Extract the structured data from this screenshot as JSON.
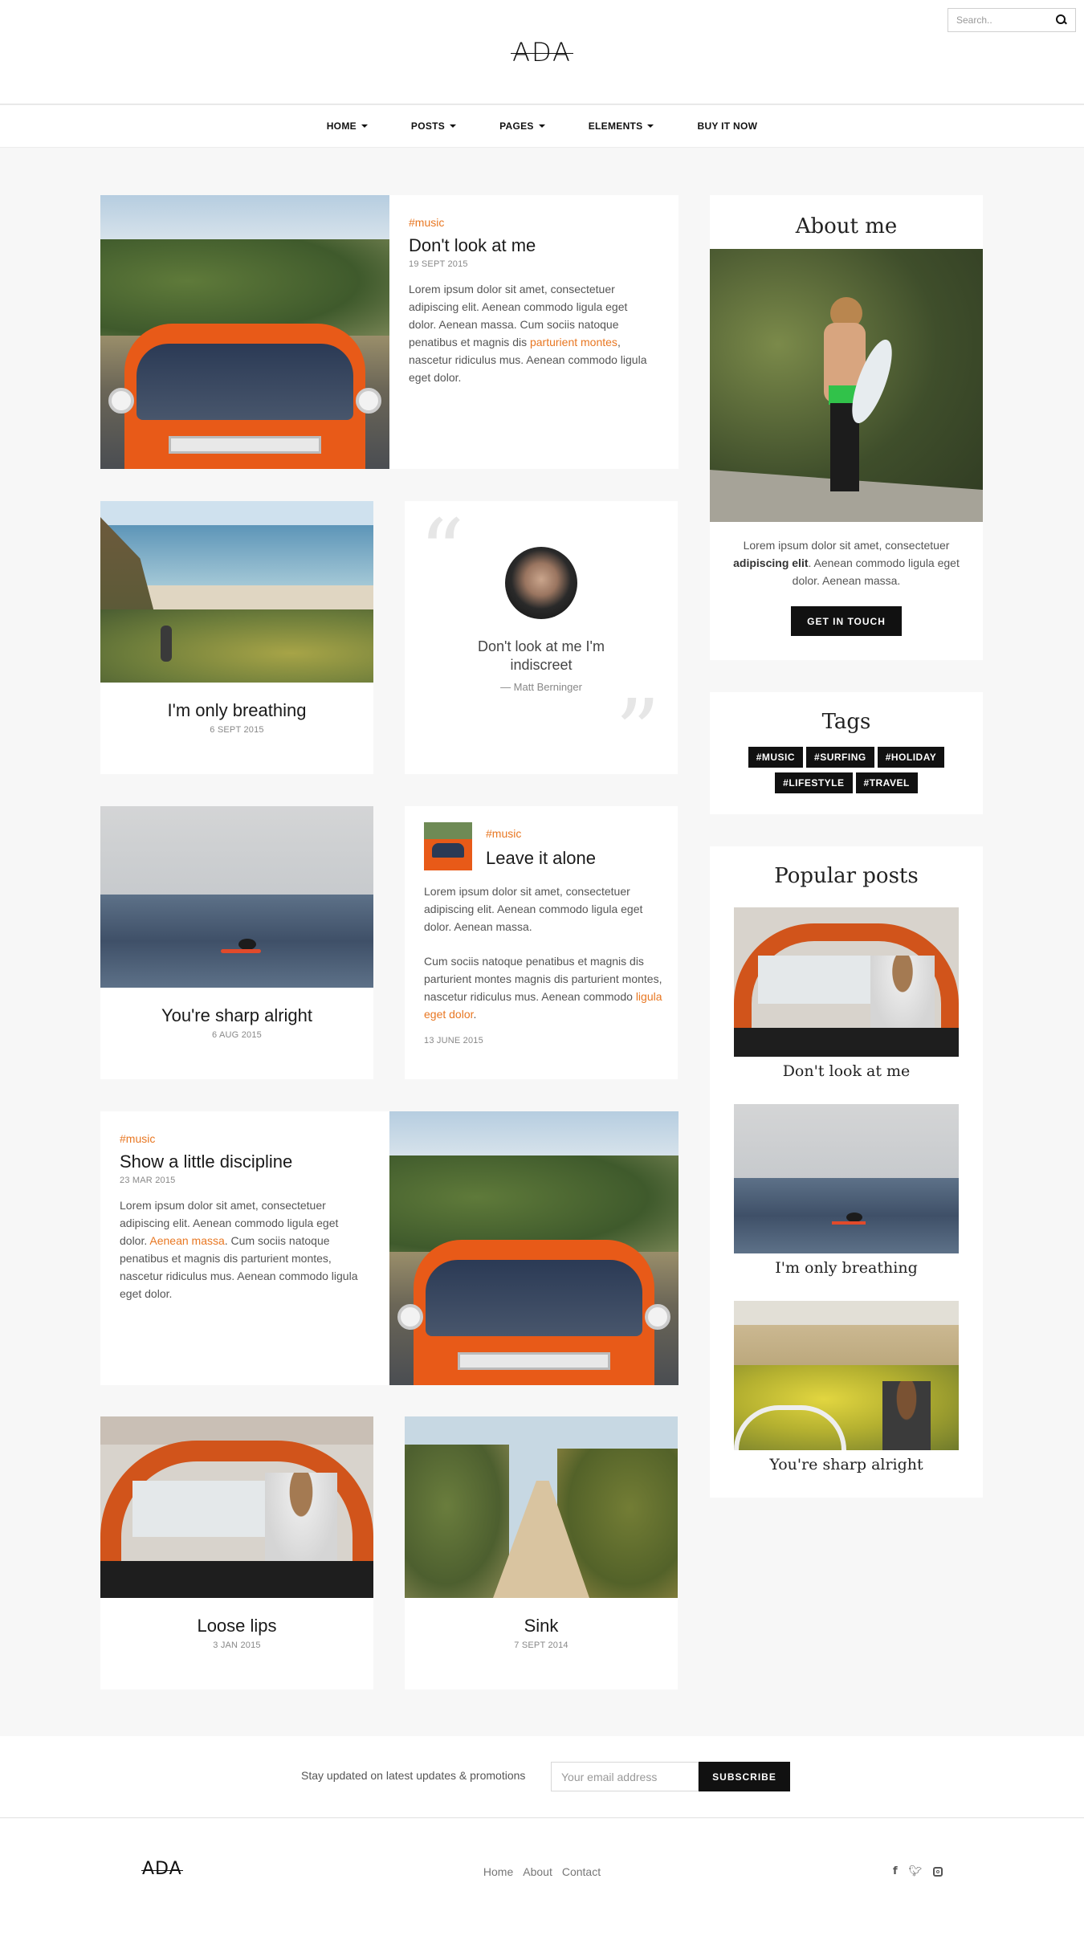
{
  "header": {
    "logo": "ADA",
    "search_placeholder": "Search.."
  },
  "nav": {
    "items": [
      {
        "label": "HOME",
        "dropdown": true
      },
      {
        "label": "POSTS",
        "dropdown": true
      },
      {
        "label": "PAGES",
        "dropdown": true
      },
      {
        "label": "ELEMENTS",
        "dropdown": true
      },
      {
        "label": "BUY IT NOW",
        "dropdown": false
      }
    ]
  },
  "posts": {
    "featured1": {
      "tag": "#music",
      "title": "Don't look at me",
      "date": "19 SEPT 2015",
      "body_start": "Lorem ipsum dolor sit amet, consectetuer adipiscing elit. Aenean commodo ligula eget dolor. Aenean massa. Cum sociis natoque penatibus et magnis dis ",
      "body_link": "parturient montes",
      "body_end": ", nascetur ridiculus mus. Aenean commodo ligula eget dolor."
    },
    "breathing": {
      "title": "I'm only breathing",
      "date": "6 SEPT 2015"
    },
    "quote": {
      "text": "Don't look at me I'm indiscreet",
      "author": "— Matt Berninger"
    },
    "sharp": {
      "title": "You're sharp alright",
      "date": "6 AUG 2015"
    },
    "alone": {
      "tag": "#music",
      "title": "Leave it alone",
      "p1": "Lorem ipsum dolor sit amet, consectetuer adipiscing elit. Aenean commodo ligula eget dolor. Aenean massa.",
      "p2_start": "Cum sociis natoque penatibus et magnis dis parturient montes magnis dis parturient montes, nascetur ridiculus mus. Aenean commodo ",
      "p2_link": "ligula eget dolor",
      "p2_end": ".",
      "date": "13 JUNE 2015"
    },
    "discipline": {
      "tag": "#music",
      "title": "Show a little discipline",
      "date": "23 MAR 2015",
      "body_start": "Lorem ipsum dolor sit amet, consectetuer adipiscing elit. Aenean commodo ligula eget dolor. ",
      "body_link": "Aenean massa",
      "body_end": ". Cum sociis natoque penatibus et magnis dis parturient montes, nascetur ridiculus mus. Aenean commodo ligula eget dolor."
    },
    "loose": {
      "title": "Loose lips",
      "date": "3 JAN 2015"
    },
    "sink": {
      "title": "Sink",
      "date": "7 SEPT 2014"
    }
  },
  "sidebar": {
    "about": {
      "title": "About me",
      "text_start": "Lorem ipsum dolor sit amet, consectetuer ",
      "text_bold": "adipiscing elit",
      "text_end": ". Aenean commodo ligula eget dolor. Aenean massa.",
      "button": "GET IN TOUCH"
    },
    "tags": {
      "title": "Tags",
      "items": [
        "#MUSIC",
        "#SURFING",
        "#HOLIDAY",
        "#LIFESTYLE",
        "#TRAVEL"
      ]
    },
    "popular": {
      "title": "Popular posts",
      "items": [
        "Don't look at me",
        "I'm only breathing",
        "You're sharp alright"
      ]
    }
  },
  "newsletter": {
    "text": "Stay updated on latest updates & promotions",
    "placeholder": "Your email address",
    "button": "SUBSCRIBE"
  },
  "footer": {
    "logo": "ADA",
    "links": [
      "Home",
      "About",
      "Contact"
    ],
    "social": [
      "f",
      "t",
      "ig"
    ]
  },
  "colors": {
    "accent": "#e87722",
    "dark": "#111111",
    "bg": "#f7f7f7"
  }
}
